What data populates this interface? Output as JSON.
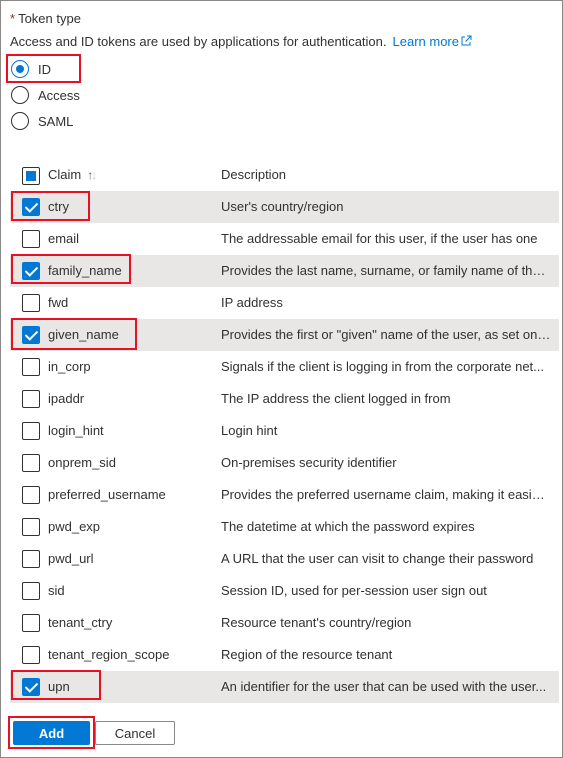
{
  "token_type": {
    "required_marker": "*",
    "label": "Token type",
    "description": "Access and ID tokens are used by applications for authentication.",
    "learn_more": "Learn more",
    "options": [
      {
        "label": "ID",
        "selected": true
      },
      {
        "label": "Access",
        "selected": false
      },
      {
        "label": "SAML",
        "selected": false
      }
    ]
  },
  "table": {
    "col_claim": "Claim",
    "col_description": "Description",
    "sort_icon": "↑↓",
    "header_checkbox_state": "partial",
    "rows": [
      {
        "claim": "ctry",
        "description": "User's country/region",
        "checked": true
      },
      {
        "claim": "email",
        "description": "The addressable email for this user, if the user has one",
        "checked": false
      },
      {
        "claim": "family_name",
        "description": "Provides the last name, surname, or family name of the ...",
        "checked": true
      },
      {
        "claim": "fwd",
        "description": "IP address",
        "checked": false
      },
      {
        "claim": "given_name",
        "description": "Provides the first or \"given\" name of the user, as set on ...",
        "checked": true
      },
      {
        "claim": "in_corp",
        "description": "Signals if the client is logging in from the corporate net...",
        "checked": false
      },
      {
        "claim": "ipaddr",
        "description": "The IP address the client logged in from",
        "checked": false
      },
      {
        "claim": "login_hint",
        "description": "Login hint",
        "checked": false
      },
      {
        "claim": "onprem_sid",
        "description": "On-premises security identifier",
        "checked": false
      },
      {
        "claim": "preferred_username",
        "description": "Provides the preferred username claim, making it easier...",
        "checked": false
      },
      {
        "claim": "pwd_exp",
        "description": "The datetime at which the password expires",
        "checked": false
      },
      {
        "claim": "pwd_url",
        "description": "A URL that the user can visit to change their password",
        "checked": false
      },
      {
        "claim": "sid",
        "description": "Session ID, used for per-session user sign out",
        "checked": false
      },
      {
        "claim": "tenant_ctry",
        "description": "Resource tenant's country/region",
        "checked": false
      },
      {
        "claim": "tenant_region_scope",
        "description": "Region of the resource tenant",
        "checked": false
      },
      {
        "claim": "upn",
        "description": "An identifier for the user that can be used with the user...",
        "checked": true
      }
    ]
  },
  "buttons": {
    "add": "Add",
    "cancel": "Cancel"
  },
  "colors": {
    "accent": "#0078d4",
    "highlight": "#e81123",
    "selected_row": "#e9e7e5"
  },
  "icons": {
    "external_link": "external-link-icon",
    "sort": "sort-icon"
  }
}
